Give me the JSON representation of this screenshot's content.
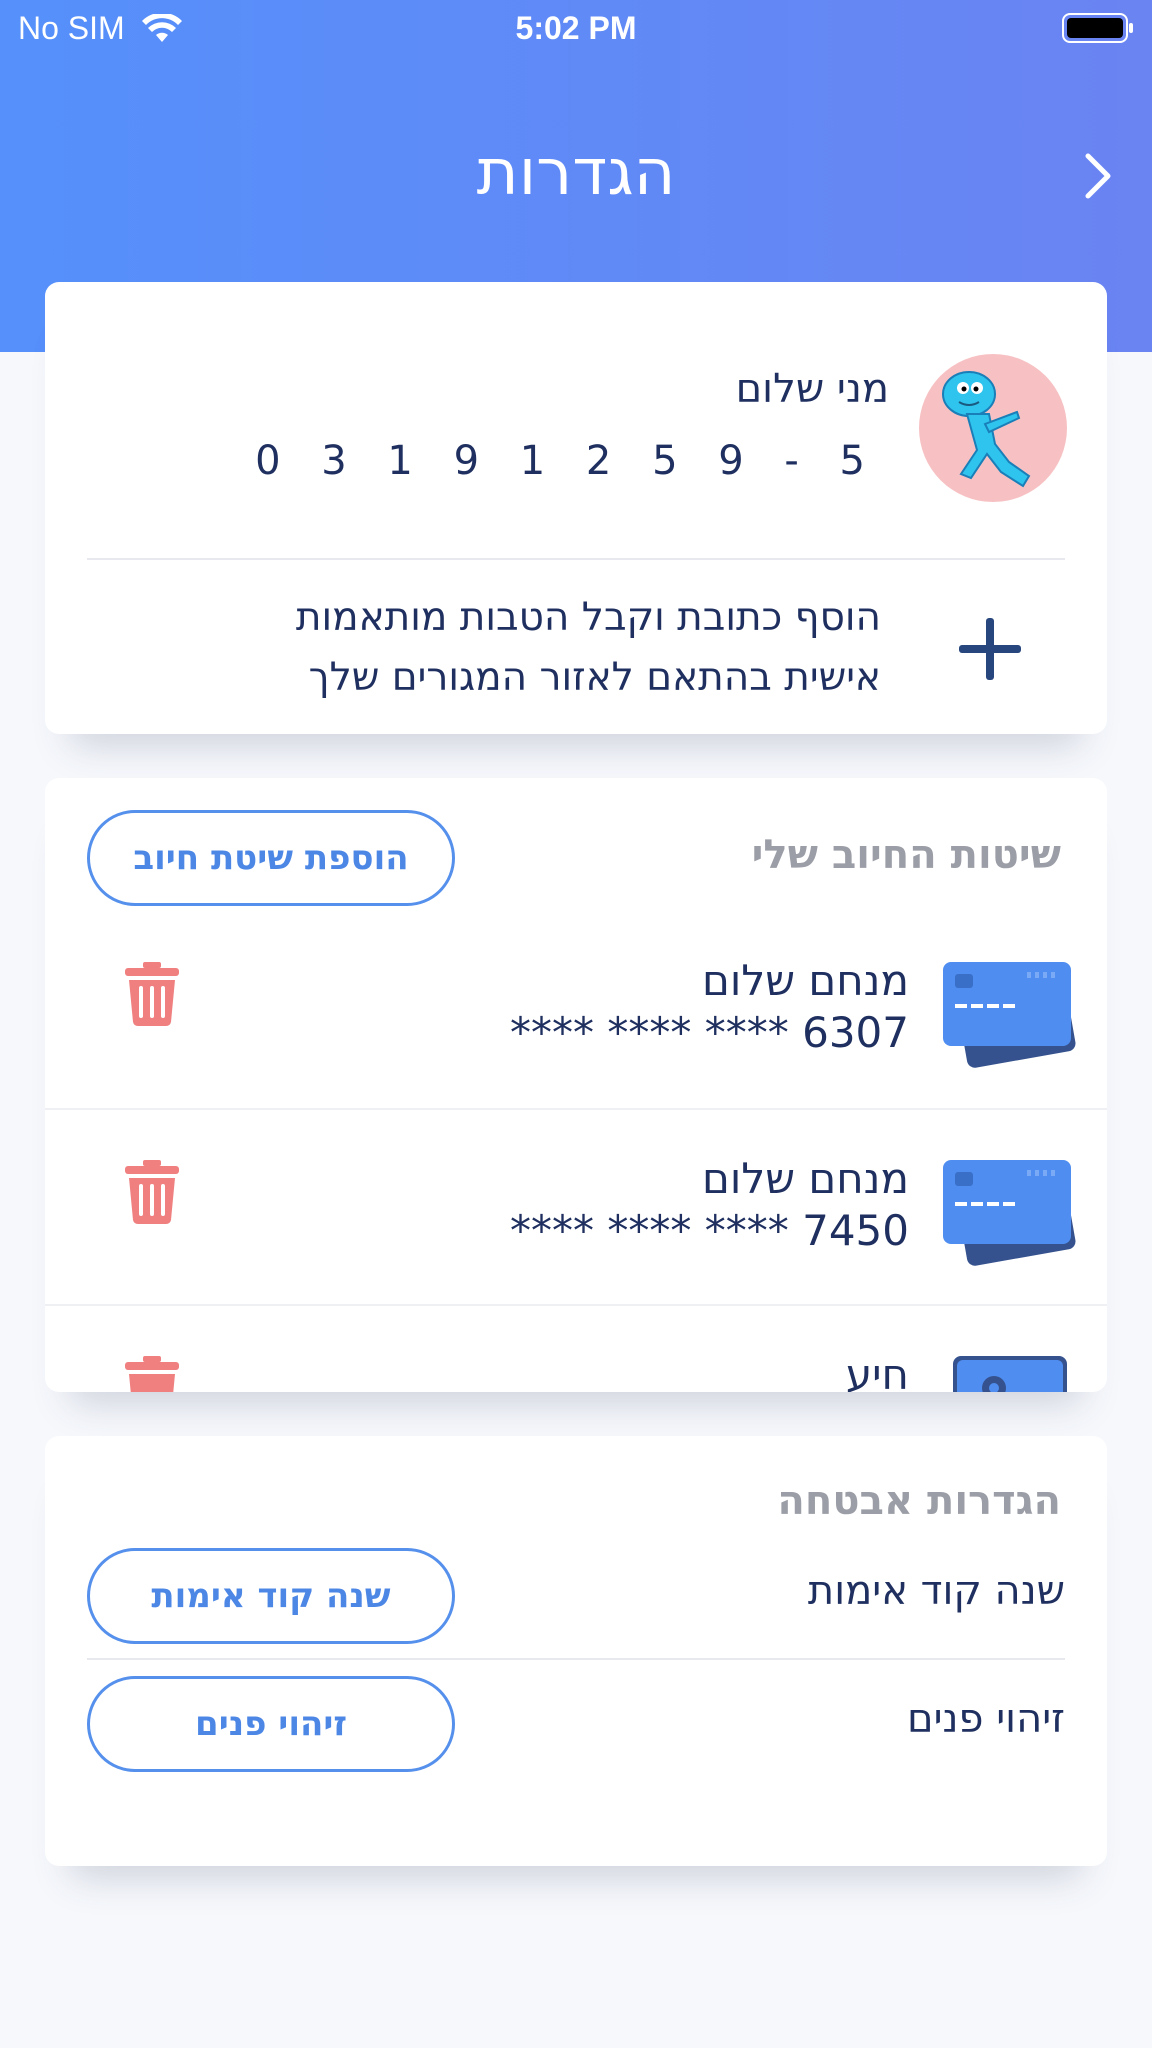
{
  "status_bar": {
    "carrier": "No SIM",
    "time": "5:02 PM"
  },
  "header": {
    "title": "הגדרות",
    "back_icon": "chevron-right-icon"
  },
  "profile": {
    "name": "מני שלום",
    "phone": "0 3 1 9 1 2 5 9 - 5",
    "avatar_icon": "cartoon-avatar",
    "add_address": {
      "line1": "הוסף כתובת וקבל הטבות מותאמות",
      "line2": "אישית בהתאם לאזור המגורים שלך",
      "icon": "plus-icon"
    }
  },
  "payment": {
    "title": "שיטות החיוב שלי",
    "add_button": "הוספת שיטת חיוב",
    "methods": [
      {
        "name": "מנחם שלום",
        "number": "****   ****   ****   6307",
        "icon": "credit-card-icon"
      },
      {
        "name": "מנחם שלום",
        "number": "****   ****   ****   7450",
        "icon": "credit-card-icon"
      },
      {
        "name": "חיע",
        "number": "",
        "icon": "wallet-icon"
      }
    ]
  },
  "security": {
    "title": "הגדרות אבטחה",
    "items": [
      {
        "label": "שנה קוד אימות",
        "button": "שנה קוד אימות"
      },
      {
        "label": "זיהוי פנים",
        "button": "זיהוי פנים"
      }
    ]
  },
  "colors": {
    "header_gradient_start": "#5590fb",
    "header_gradient_end": "#6a84f2",
    "accent": "#5590ec",
    "delete": "#f08080",
    "text": "#1f3060"
  }
}
